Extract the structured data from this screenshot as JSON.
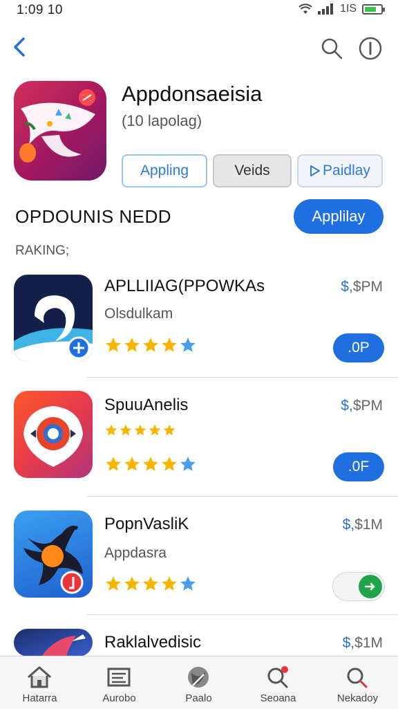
{
  "status": {
    "time": "1:09 10",
    "signal_text": "1IS"
  },
  "colors": {
    "accent": "#1f6fe0",
    "star": "#f7b500",
    "star_alt": "#4a9de8",
    "toggle": "#21a34a"
  },
  "header": {
    "back_icon": "chevron-left-icon",
    "search_icon": "search-icon",
    "info_icon": "info-icon"
  },
  "app": {
    "title": "Appdonsaeisia",
    "subtitle": "(10 lapolag)",
    "pills": [
      "Appling",
      "Veids",
      "Paidlay"
    ]
  },
  "section": {
    "title": "OPDOUNIS NEDD",
    "button": "Applilay",
    "ranking_label": "RAKING;"
  },
  "list": [
    {
      "title": "APLLIIAG(PPOWKAs",
      "subtitle": "Olsdulkam",
      "price_symbol": "$,",
      "price": "$PM",
      "rating": 4.5,
      "button": ".0P"
    },
    {
      "title": "SpuuAnelis",
      "subtitle": "",
      "price_symbol": "$,",
      "price": "$PM",
      "rating": 4.5,
      "button": ".0F"
    },
    {
      "title": "PopnVasliK",
      "subtitle": "Appdasra",
      "price_symbol": "$,",
      "price": "$1M",
      "rating": 4.5,
      "button": ""
    },
    {
      "title": "Raklalvedisic",
      "subtitle": "",
      "price_symbol": "$,",
      "price": "$1M",
      "rating": 0,
      "button": ""
    }
  ],
  "tabs": [
    {
      "label": "Hatarra",
      "icon": "home-icon"
    },
    {
      "label": "Aurobo",
      "icon": "apps-icon"
    },
    {
      "label": "Paalo",
      "icon": "games-icon"
    },
    {
      "label": "Seoana",
      "icon": "search-icon"
    },
    {
      "label": "Nekadoy",
      "icon": "search-icon"
    }
  ]
}
